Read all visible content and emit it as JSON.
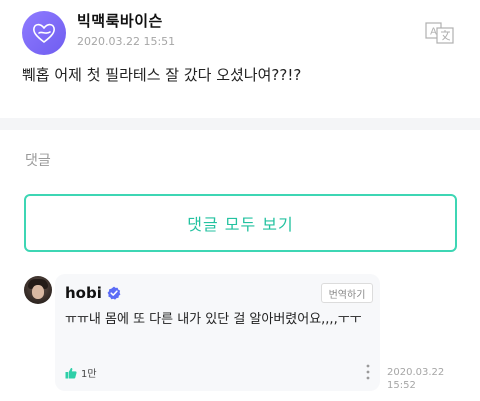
{
  "post": {
    "author": "빅맥룩바이슨",
    "date": "2020.03.22 15:51",
    "text": "쀄홉 어제 첫 필라테스 잘 갔다 오셨나여??!?"
  },
  "comments": {
    "title": "댓글",
    "view_all_label": "댓글 모두 보기",
    "items": [
      {
        "author": "hobi",
        "translate_label": "번역하기",
        "text": "ㅠㅠ내 몸에 또 다른 내가 있단 걸 알아버렸어요,,,,ㅜㅜ",
        "likes": "1만",
        "date_line1": "2020.03.22",
        "date_line2": "15:52"
      }
    ]
  },
  "colors": {
    "accent": "#3dd6b4",
    "accent_text": "#24c2a0",
    "verified": "#5b6cf6",
    "avatar": "#7a67f7"
  },
  "icons": {
    "translate": "translate-icon",
    "verified": "verified-badge-icon",
    "like": "thumbs-up-icon",
    "more": "more-vertical-icon"
  }
}
